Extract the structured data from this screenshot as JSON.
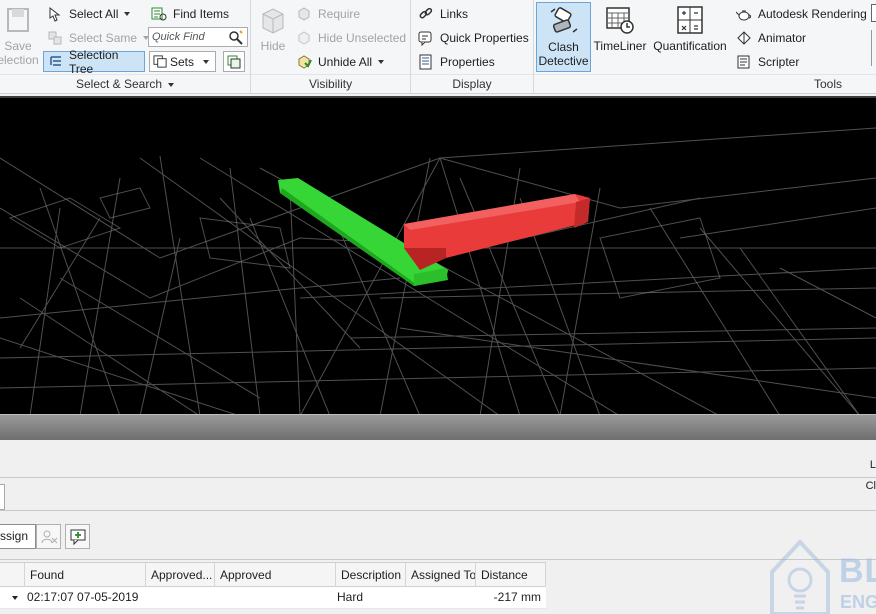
{
  "ribbon": {
    "select_search": {
      "save_selection_label_line1": "Save",
      "save_selection_label_line2": "election",
      "select_all": "Select All",
      "select_same": "Select Same",
      "selection_tree": "Selection Tree",
      "find_items": "Find Items",
      "quick_find_placeholder": "Quick Find",
      "sets": "Sets",
      "group_label": "Select & Search"
    },
    "visibility": {
      "hide": "Hide",
      "require": "Require",
      "hide_unselected": "Hide Unselected",
      "unhide_all": "Unhide All",
      "group_label": "Visibility"
    },
    "display": {
      "links": "Links",
      "quick_properties": "Quick Properties",
      "properties": "Properties",
      "group_label": "Display"
    },
    "tools": {
      "clash_line1": "Clash",
      "clash_line2": "Detective",
      "timeliner": "TimeLiner",
      "quantification": "Quantification",
      "autodesk_rendering": "Autodesk Rendering",
      "animator": "Animator",
      "scripter": "Scripter",
      "group_label": "Tools"
    }
  },
  "panel": {
    "right_letter_1": "L",
    "right_letter_2": "Cl",
    "assign_label": "ssign"
  },
  "table": {
    "columns": [
      "Found",
      "Approved...",
      "Approved",
      "Description",
      "Assigned To",
      "Distance"
    ],
    "rows": [
      {
        "found": "02:17:07 07-05-2019",
        "approved_by": "",
        "approved": "",
        "description": "Hard",
        "assigned_to": "",
        "distance": "-217 mm"
      }
    ]
  },
  "watermark": {
    "line1": "BL",
    "line2": "ENG"
  },
  "colors": {
    "accent": "#cde4f7",
    "clash_green": "#2ecc2e",
    "clash_red": "#e83a3a",
    "viewport_bg": "#000000"
  }
}
